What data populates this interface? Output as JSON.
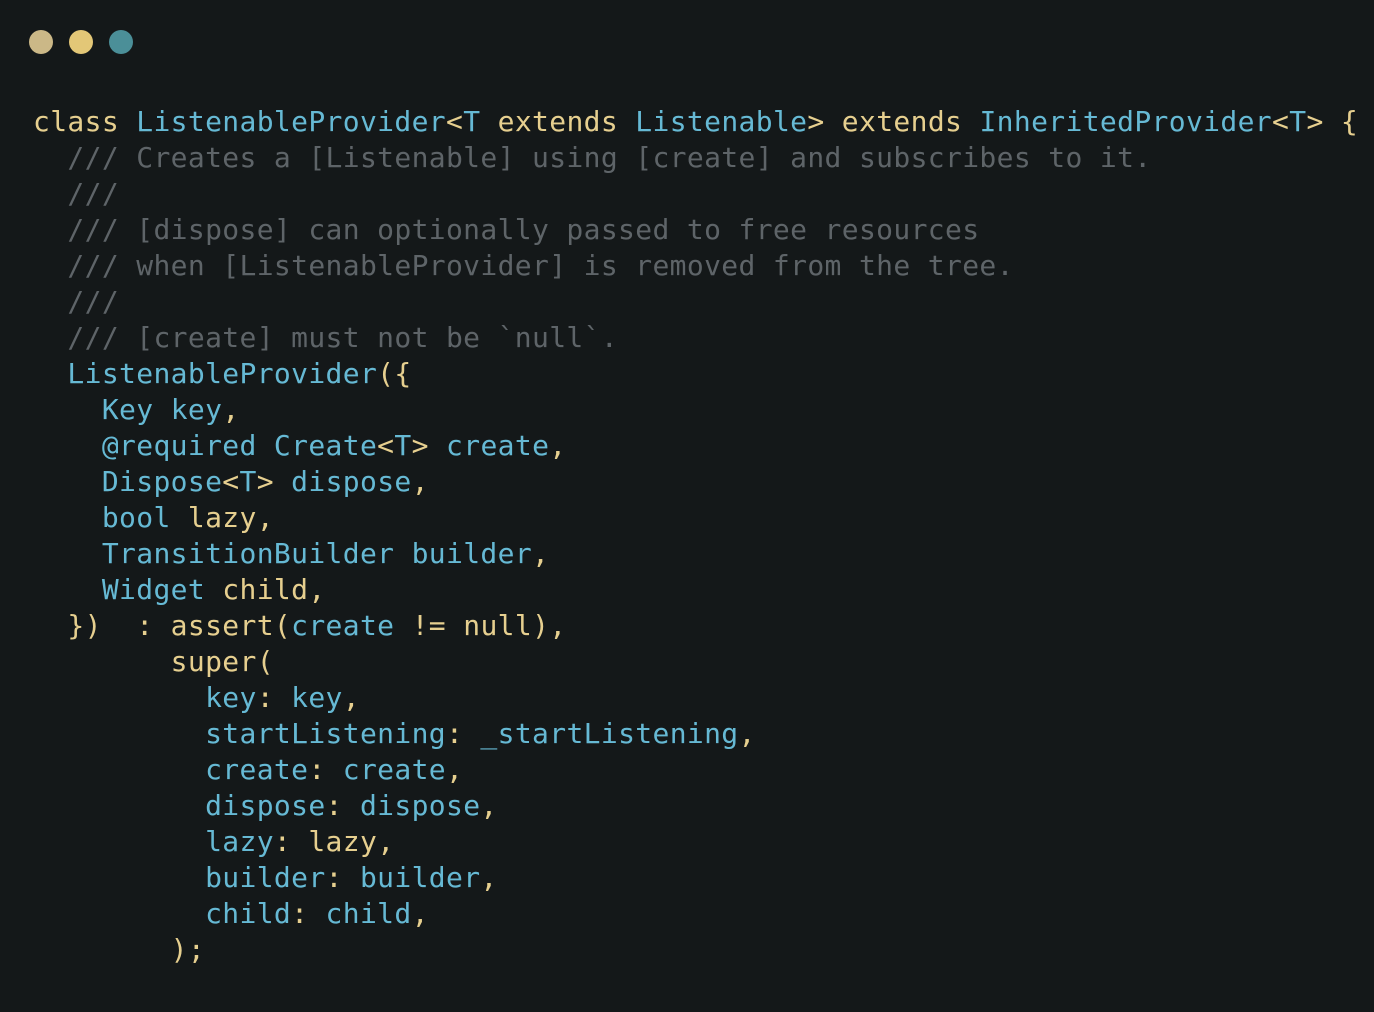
{
  "window": {
    "controls": [
      {
        "name": "close",
        "color": "#cbb887"
      },
      {
        "name": "minimize",
        "color": "#e3c777"
      },
      {
        "name": "maximize",
        "color": "#4b8f98"
      }
    ]
  },
  "colors": {
    "background": "#141819",
    "keyword": "#e6cf8f",
    "type": "#66b9d4",
    "comment": "#5e6468"
  },
  "code": {
    "lines": [
      [
        [
          "keyword",
          "class "
        ],
        [
          "type",
          "ListenableProvider"
        ],
        [
          "punct",
          "<"
        ],
        [
          "type",
          "T"
        ],
        [
          "keyword",
          " extends "
        ],
        [
          "type",
          "Listenable"
        ],
        [
          "punct",
          "> "
        ],
        [
          "keyword",
          "extends "
        ],
        [
          "type",
          "InheritedProvider"
        ],
        [
          "punct",
          "<"
        ],
        [
          "type",
          "T"
        ],
        [
          "punct",
          "> {"
        ]
      ],
      [
        [
          "comment",
          "  /// Creates a [Listenable] using [create] and subscribes to it."
        ]
      ],
      [
        [
          "comment",
          "  ///"
        ]
      ],
      [
        [
          "comment",
          "  /// [dispose] can optionally passed to free resources"
        ]
      ],
      [
        [
          "comment",
          "  /// when [ListenableProvider] is removed from the tree."
        ]
      ],
      [
        [
          "comment",
          "  ///"
        ]
      ],
      [
        [
          "comment",
          "  /// [create] must not be `null`."
        ]
      ],
      [
        [
          "plain",
          "  "
        ],
        [
          "type",
          "ListenableProvider"
        ],
        [
          "punct",
          "({"
        ]
      ],
      [
        [
          "plain",
          "    "
        ],
        [
          "type",
          "Key "
        ],
        [
          "param",
          "key"
        ],
        [
          "punct",
          ","
        ]
      ],
      [
        [
          "plain",
          "    "
        ],
        [
          "type",
          "@required Create"
        ],
        [
          "punct",
          "<"
        ],
        [
          "type",
          "T"
        ],
        [
          "punct",
          "> "
        ],
        [
          "param",
          "create"
        ],
        [
          "punct",
          ","
        ]
      ],
      [
        [
          "plain",
          "    "
        ],
        [
          "type",
          "Dispose"
        ],
        [
          "punct",
          "<"
        ],
        [
          "type",
          "T"
        ],
        [
          "punct",
          "> "
        ],
        [
          "param",
          "dispose"
        ],
        [
          "punct",
          ","
        ]
      ],
      [
        [
          "plain",
          "    "
        ],
        [
          "type",
          "bool "
        ],
        [
          "plain",
          "lazy"
        ],
        [
          "punct",
          ","
        ]
      ],
      [
        [
          "plain",
          "    "
        ],
        [
          "type",
          "TransitionBuilder "
        ],
        [
          "param",
          "builder"
        ],
        [
          "punct",
          ","
        ]
      ],
      [
        [
          "plain",
          "    "
        ],
        [
          "type",
          "Widget "
        ],
        [
          "plain",
          "child"
        ],
        [
          "punct",
          ","
        ]
      ],
      [
        [
          "punct",
          "  })  : "
        ],
        [
          "plain",
          "assert"
        ],
        [
          "punct",
          "("
        ],
        [
          "param",
          "create"
        ],
        [
          "punct",
          " != "
        ],
        [
          "plain",
          "null"
        ],
        [
          "punct",
          "),"
        ]
      ],
      [
        [
          "plain",
          "        super"
        ],
        [
          "punct",
          "("
        ]
      ],
      [
        [
          "plain",
          "          "
        ],
        [
          "param",
          "key"
        ],
        [
          "punct",
          ": "
        ],
        [
          "param",
          "key"
        ],
        [
          "punct",
          ","
        ]
      ],
      [
        [
          "plain",
          "          "
        ],
        [
          "param",
          "startListening"
        ],
        [
          "punct",
          ": "
        ],
        [
          "param",
          "_startListening"
        ],
        [
          "punct",
          ","
        ]
      ],
      [
        [
          "plain",
          "          "
        ],
        [
          "param",
          "create"
        ],
        [
          "punct",
          ": "
        ],
        [
          "param",
          "create"
        ],
        [
          "punct",
          ","
        ]
      ],
      [
        [
          "plain",
          "          "
        ],
        [
          "param",
          "dispose"
        ],
        [
          "punct",
          ": "
        ],
        [
          "param",
          "dispose"
        ],
        [
          "punct",
          ","
        ]
      ],
      [
        [
          "plain",
          "          "
        ],
        [
          "param",
          "lazy"
        ],
        [
          "punct",
          ": "
        ],
        [
          "plain",
          "lazy"
        ],
        [
          "punct",
          ","
        ]
      ],
      [
        [
          "plain",
          "          "
        ],
        [
          "param",
          "builder"
        ],
        [
          "punct",
          ": "
        ],
        [
          "param",
          "builder"
        ],
        [
          "punct",
          ","
        ]
      ],
      [
        [
          "plain",
          "          "
        ],
        [
          "param",
          "child"
        ],
        [
          "punct",
          ": "
        ],
        [
          "param",
          "child"
        ],
        [
          "punct",
          ","
        ]
      ],
      [
        [
          "punct",
          "        );"
        ]
      ]
    ]
  }
}
